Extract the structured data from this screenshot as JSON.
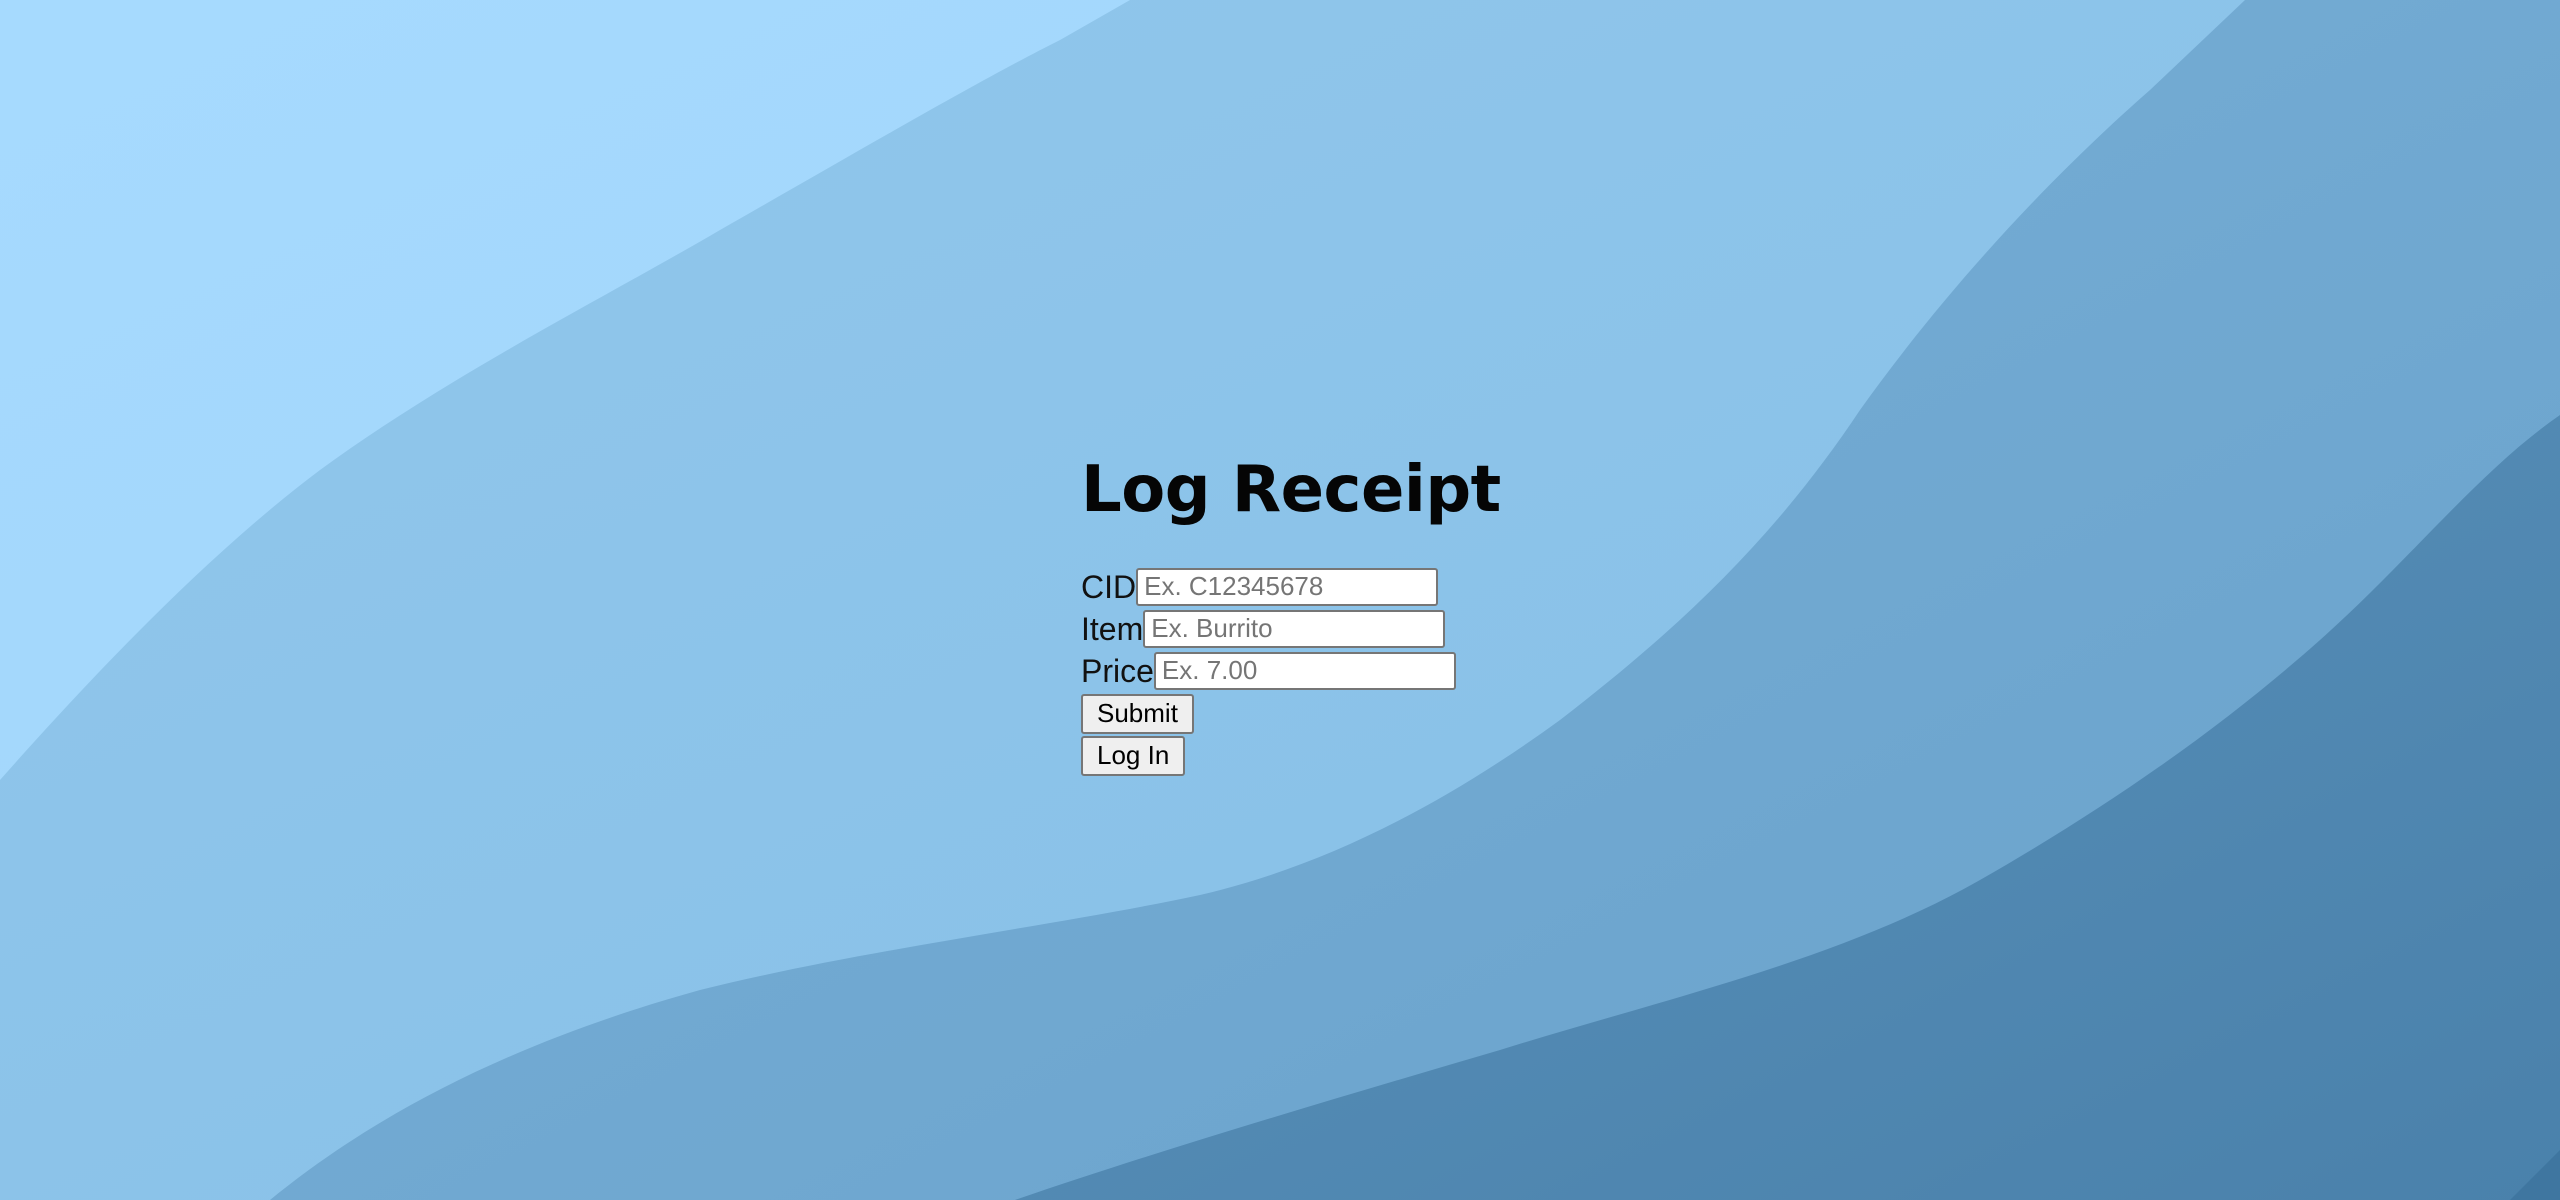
{
  "page": {
    "title": "Log Receipt"
  },
  "form": {
    "cid": {
      "label": "CID",
      "value": "",
      "placeholder": "Ex. C12345678"
    },
    "item": {
      "label": "Item",
      "value": "",
      "placeholder": "Ex. Burrito"
    },
    "price": {
      "label": "Price",
      "value": "",
      "placeholder": "Ex. 7.00"
    },
    "submit_label": "Submit",
    "login_label": "Log In"
  },
  "colors": {
    "background_light": "#a3d8fd",
    "background_layer_2": "#8dc3e9",
    "background_layer_3": "#72a9d1",
    "background_dark": "#4f87b1",
    "title_text": "#050505"
  }
}
